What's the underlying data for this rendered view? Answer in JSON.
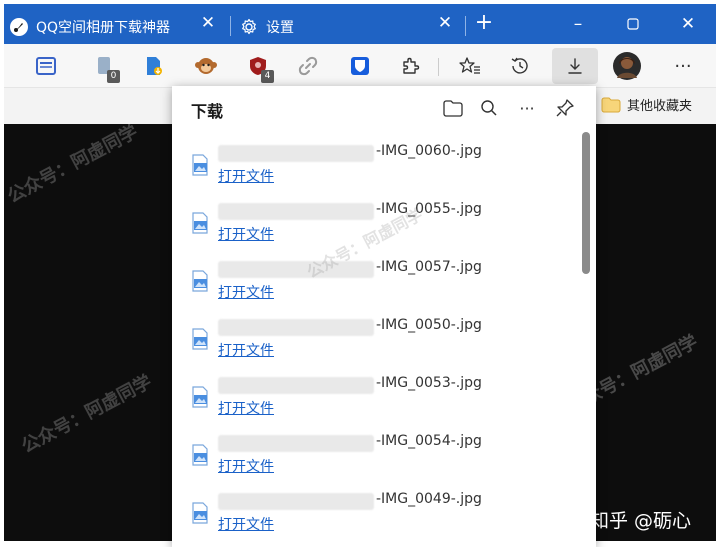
{
  "tabs": [
    {
      "title": "QQ空间相册下载神器",
      "icon": "app-logo-icon",
      "active": false
    },
    {
      "title": "设置",
      "icon": "gear-icon",
      "active": true
    }
  ],
  "window": {
    "new_tab_icon": "plus-icon",
    "minimize_icon": "minimize-icon",
    "maximize_icon": "maximize-icon",
    "close_icon": "close-icon"
  },
  "toolbar": {
    "badge_a": "0",
    "badge_b": "4",
    "more_icon": "more-icon",
    "icons": [
      "reading-view-icon",
      "extension-a-icon",
      "download-extension-icon",
      "monkey-extension-icon",
      "shield-extension-icon",
      "link-icon",
      "bitwarden-icon",
      "puzzle-icon",
      "favorites-icon",
      "history-icon",
      "download-icon",
      "profile-avatar"
    ]
  },
  "bookmarks": {
    "other_folder": "其他收藏夹"
  },
  "downloads_panel": {
    "title": "下载",
    "icons": [
      "folder-icon",
      "search-icon",
      "more-icon",
      "pin-icon"
    ],
    "open_label": "打开文件",
    "items": [
      {
        "name": "-IMG_0060-.jpg"
      },
      {
        "name": "-IMG_0055-.jpg"
      },
      {
        "name": "-IMG_0057-.jpg"
      },
      {
        "name": "-IMG_0050-.jpg"
      },
      {
        "name": "-IMG_0053-.jpg"
      },
      {
        "name": "-IMG_0054-.jpg"
      },
      {
        "name": "-IMG_0049-.jpg"
      }
    ]
  },
  "watermark_text": "公众号：阿虚同学",
  "footer_credit": "知乎 @砺心",
  "colors": {
    "tabbar": "#1f63c4",
    "link": "#1a61c8",
    "page_bg": "#0d0d0d"
  }
}
